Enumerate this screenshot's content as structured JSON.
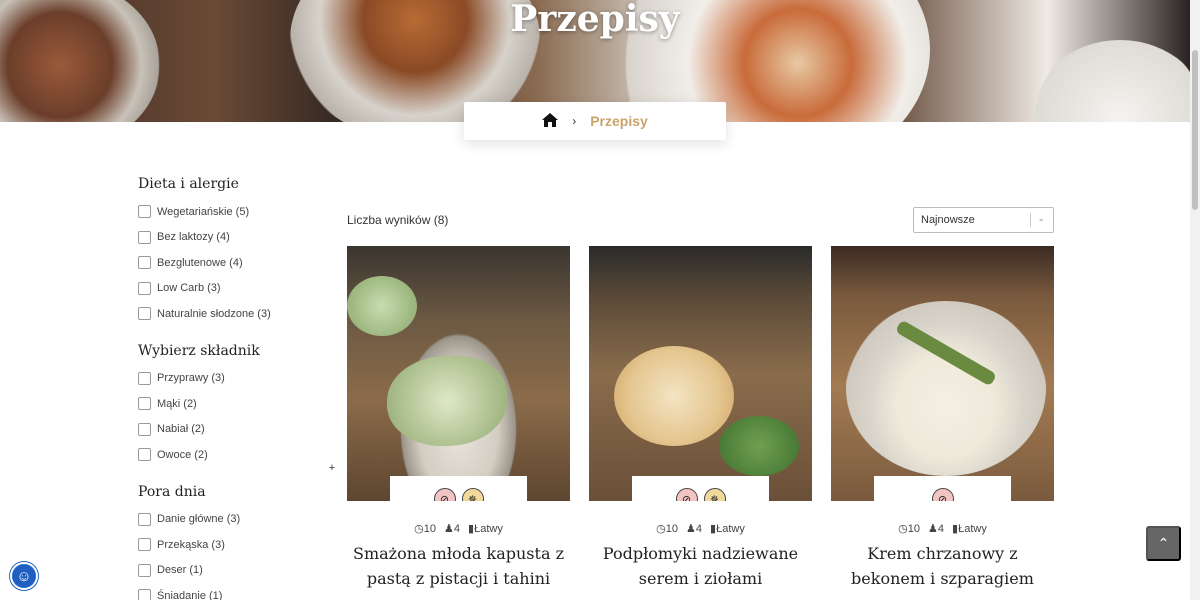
{
  "hero": {
    "title": "Przepisy"
  },
  "breadcrumb": {
    "home_icon": "home-icon",
    "separator": "›",
    "current": "Przepisy"
  },
  "filters": [
    {
      "title": "Dieta i alergie",
      "items": [
        "Wegetariańskie (5)",
        "Bez laktozy (4)",
        "Bezglutenowe (4)",
        "Low Carb (3)",
        "Naturalnie słodzone (3)"
      ]
    },
    {
      "title": "Wybierz składnik",
      "items": [
        "Przyprawy (3)",
        "Mąki (2)",
        "Nabiał (2)",
        "Owoce (2)"
      ],
      "expand_icon": "+"
    },
    {
      "title": "Pora dnia",
      "items": [
        "Danie główne (3)",
        "Przekąska (3)",
        "Deser (1)",
        "Śniadanie (1)"
      ]
    }
  ],
  "results": {
    "count_label": "Liczba wyników (8)"
  },
  "sort": {
    "selected": "Najnowsze"
  },
  "cards": [
    {
      "time": "10",
      "servings": "4",
      "difficulty": "Łatwy",
      "title": "Smażona młoda kapusta z pastą z pistacji i tahini",
      "badges": [
        "no-lactose-icon",
        "no-gluten-icon",
        "leaf-icon"
      ]
    },
    {
      "time": "10",
      "servings": "4",
      "difficulty": "Łatwy",
      "title": "Podpłomyki nadziewane serem i ziołami",
      "badges": [
        "no-sugar-icon",
        "grain-icon"
      ]
    },
    {
      "time": "10",
      "servings": "4",
      "difficulty": "Łatwy",
      "title": "Krem chrzanowy z bekonem i szparagiem",
      "badges": [
        "no-gluten-icon"
      ]
    }
  ],
  "colors": {
    "accent": "#c9a46a",
    "a11y_button": "#1f5fbf",
    "to_top_button": "#666666"
  }
}
